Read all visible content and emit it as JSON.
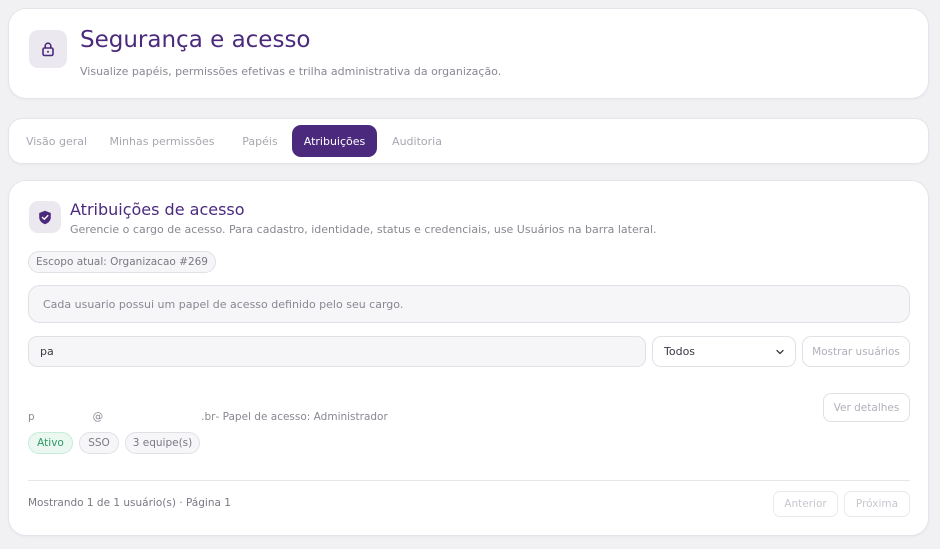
{
  "header": {
    "icon": "lock-icon",
    "title": "Segurança e acesso",
    "subtitle": "Visualize papéis, permissões efetivas e trilha administrativa da organização."
  },
  "tabs": [
    {
      "label": "Visão geral",
      "active": false
    },
    {
      "label": "Minhas permissões",
      "active": false
    },
    {
      "label": "Papéis",
      "active": false
    },
    {
      "label": "Atribuições",
      "active": true
    },
    {
      "label": "Auditoria",
      "active": false
    }
  ],
  "section": {
    "icon": "shield-check-icon",
    "title": "Atribuições de acesso",
    "description": "Gerencie o cargo de acesso. Para cadastro, identidade, status e credenciais, use Usuários na barra lateral.",
    "scope": "Escopo atual: Organizacao #269",
    "info": "Cada usuario possui um papel de acesso definido pelo seu cargo."
  },
  "filters": {
    "search_value": "pa",
    "role_filter": "Todos",
    "show_users_label": "Mostrar usuários"
  },
  "user": {
    "email_start": "p",
    "email_at": "@",
    "email_end": ".br",
    "role_text": " - Papel de acesso: Administrador",
    "details_label": "Ver detalhes",
    "badges": {
      "status": "Ativo",
      "auth": "SSO",
      "teams": "3 equipe(s)"
    }
  },
  "pagination": {
    "summary": "Mostrando 1 de 1 usuário(s) · Página 1",
    "prev_label": "Anterior",
    "next_label": "Próxima"
  },
  "colors": {
    "accent": "#4b2a7d",
    "success": "#2f9866",
    "background": "#f1f0f3"
  }
}
